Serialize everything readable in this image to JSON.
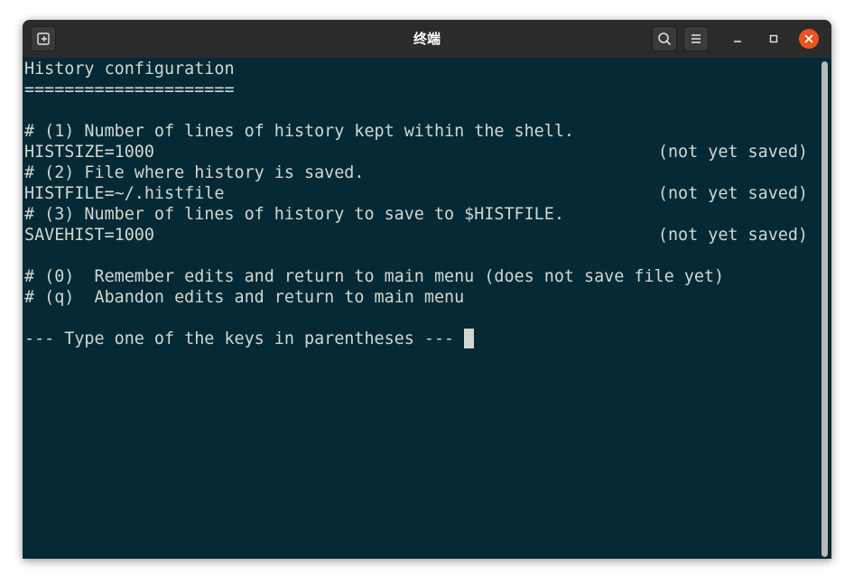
{
  "window": {
    "title": "终端"
  },
  "titlebar": {
    "icons": {
      "new_tab": "new-tab-icon",
      "search": "search-icon",
      "menu": "hamburger-menu-icon",
      "minimize": "minimize-icon",
      "maximize": "maximize-icon",
      "close": "close-icon"
    },
    "close_color": "#e95420"
  },
  "terminal": {
    "background": "#052a35",
    "foreground": "#d3d7cf",
    "lines": [
      "History configuration",
      "=====================",
      "",
      "# (1) Number of lines of history kept within the shell.",
      "HISTSIZE=1000",
      "# (2) File where history is saved.",
      "HISTFILE=~/.histfile",
      "# (3) Number of lines of history to save to $HISTFILE.",
      "SAVEHIST=1000",
      "",
      "# (0)  Remember edits and return to main menu (does not save file yet)",
      "# (q)  Abandon edits and return to main menu",
      "",
      "--- Type one of the keys in parentheses --- "
    ],
    "status": {
      "histsize": "(not yet saved)",
      "histfile": "(not yet saved)",
      "savehist": "(not yet saved)"
    }
  }
}
